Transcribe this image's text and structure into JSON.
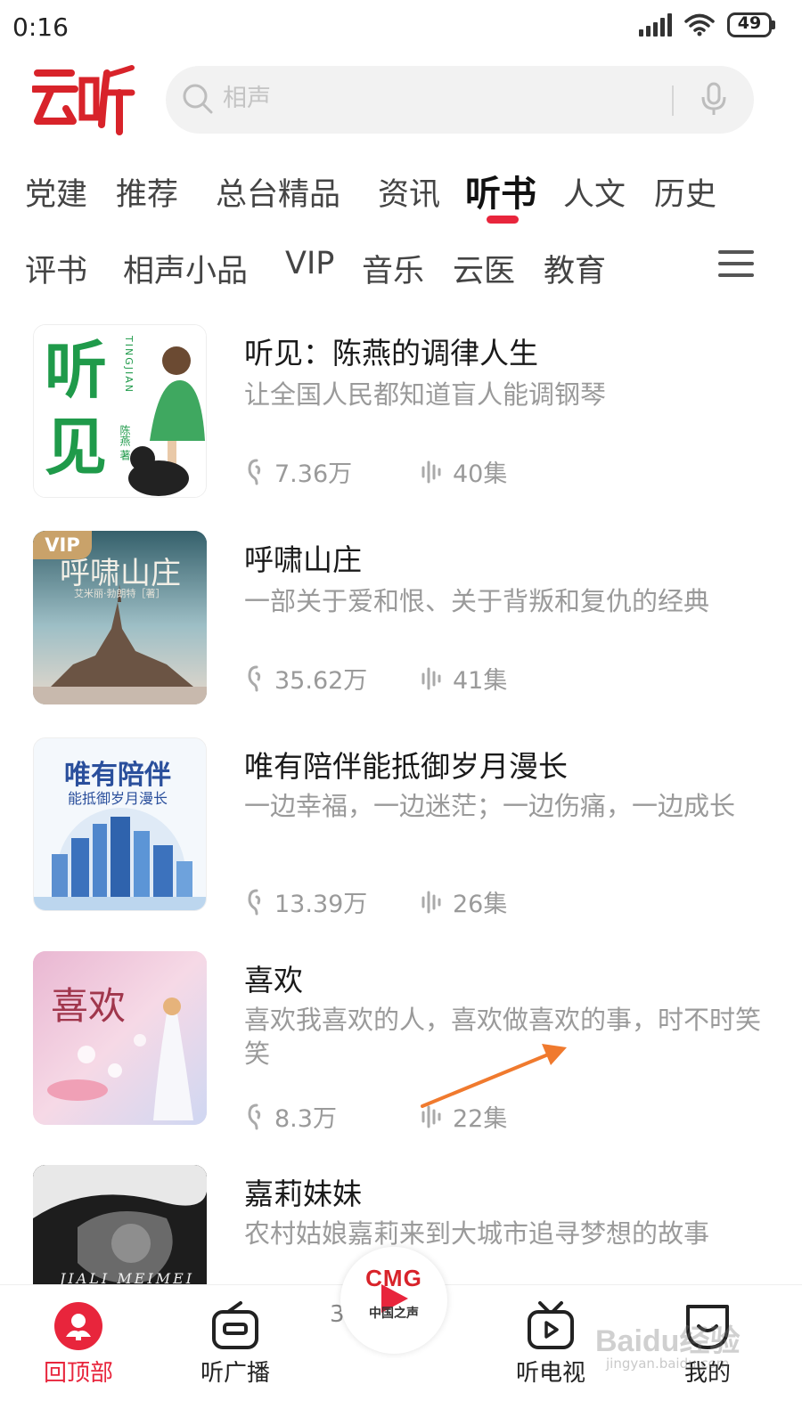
{
  "status_bar": {
    "time": "0:16",
    "battery": "49"
  },
  "header": {
    "logo_text": "云听",
    "search_placeholder": "相声"
  },
  "tabs_row1": [
    {
      "label": "党建"
    },
    {
      "label": "推荐"
    },
    {
      "label": "总台精品"
    },
    {
      "label": "资讯"
    },
    {
      "label": "听书",
      "active": true
    },
    {
      "label": "人文"
    },
    {
      "label": "历史"
    }
  ],
  "tabs_row2": [
    {
      "label": "评书"
    },
    {
      "label": "相声小品"
    },
    {
      "label": "VIP"
    },
    {
      "label": "音乐"
    },
    {
      "label": "云医"
    },
    {
      "label": "教育"
    }
  ],
  "items": [
    {
      "title": "听见：陈燕的调律人生",
      "desc": "让全国人民都知道盲人能调钢琴",
      "plays": "7.36万",
      "episodes": "40集",
      "cover_text_main": "听见",
      "cover_text_side": "TINGJIAN",
      "cover_author": "陈燕 著"
    },
    {
      "title": "呼啸山庄",
      "desc": "一部关于爱和恨、关于背叛和复仇的经典",
      "plays": "35.62万",
      "episodes": "41集",
      "cover_text_main": "呼啸山庄",
      "cover_author": "艾米丽·勃朗特［著］",
      "vip": "VIP"
    },
    {
      "title": "唯有陪伴能抵御岁月漫长",
      "desc": "一边幸福，一边迷茫；一边伤痛，一边成长",
      "plays": "13.39万",
      "episodes": "26集",
      "cover_text_main": "唯有陪伴",
      "cover_text_sub": "能抵御岁月漫长"
    },
    {
      "title": "喜欢",
      "desc": "喜欢我喜欢的人，喜欢做喜欢的事，时不时笑笑",
      "plays": "8.3万",
      "episodes": "22集",
      "cover_text_main": "喜欢"
    },
    {
      "title": "嘉莉妹妹",
      "desc": "农村姑娘嘉莉来到大城市追寻梦想的故事",
      "cover_text_main": "JIALI MEIMEI"
    }
  ],
  "bottom_nav": {
    "back_top": "回顶部",
    "radio": "听广播",
    "player_logo": "CMG",
    "player_channel": "中国之声",
    "tv": "听电视",
    "mine": "我的",
    "peek": "3"
  },
  "watermark": {
    "main": "Baidu经验",
    "sub": "jingyan.baidu.com"
  },
  "colors": {
    "accent": "#e8253c",
    "text_muted": "#9a9a9a"
  }
}
